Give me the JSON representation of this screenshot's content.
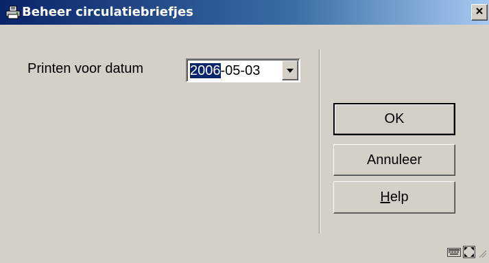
{
  "window": {
    "title": "Beheer circulatiebriefjes",
    "title_icon": "printer-document-icon",
    "close_icon": "close-icon"
  },
  "form": {
    "date_label": "Printen voor datum",
    "date_value_selected": "2006",
    "date_value_rest": "-05-03",
    "dropdown_icon": "chevron-down-icon"
  },
  "buttons": {
    "ok": "OK",
    "cancel": "Annuleer",
    "help_mnemonic": "H",
    "help_rest": "elp"
  },
  "status_bar": {
    "icons": [
      "keyboard-icon",
      "resize-icon",
      "size-grip-icon"
    ]
  },
  "colors": {
    "titlebar_start": "#0a246a",
    "titlebar_end": "#a6caf0",
    "window_bg": "#d4d0c8",
    "selection_bg": "#0a246a"
  }
}
